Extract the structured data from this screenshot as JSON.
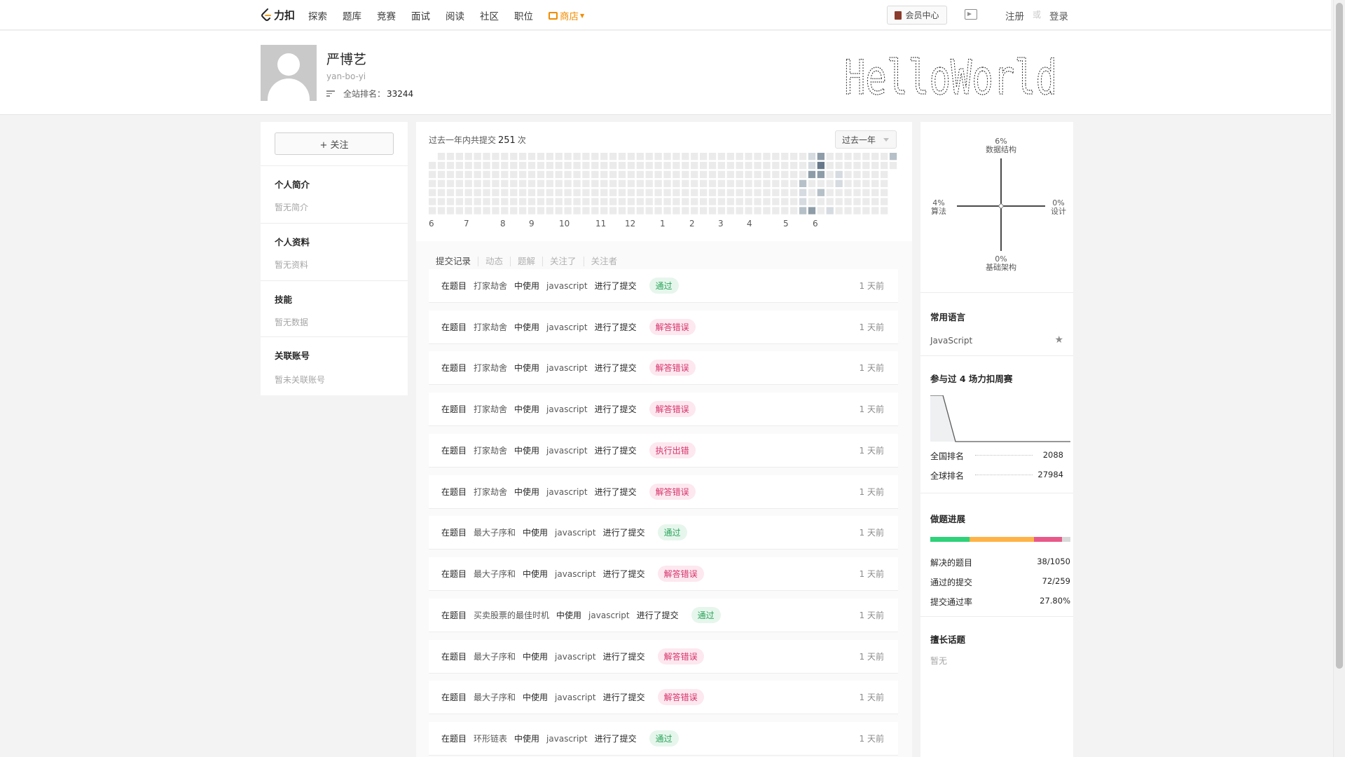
{
  "nav": {
    "logo_text": "力扣",
    "links": [
      "探索",
      "题库",
      "竞赛",
      "面试",
      "阅读",
      "社区",
      "职位"
    ],
    "store_label": "商店",
    "vip_label": "会员中心",
    "register": "注册",
    "or": "或",
    "login": "登录"
  },
  "profile": {
    "name": "严博艺",
    "username": "yan-bo-yi",
    "rank_label": "全站排名：",
    "rank_value": "33244",
    "banner_text": "HelloWorld"
  },
  "left": {
    "follow_label": "+ 关注",
    "sections": [
      {
        "title": "个人简介",
        "value": "暂无简介"
      },
      {
        "title": "个人资料",
        "value": "暂无资料"
      },
      {
        "title": "技能",
        "value": "暂无数据"
      },
      {
        "title": "关联账号",
        "value": "暂未关联账号"
      }
    ]
  },
  "activity": {
    "count_prefix": "过去一年内共提交",
    "count_value": "251",
    "count_suffix": "次",
    "range_label": "过去一年",
    "months": [
      "6",
      "7",
      "8",
      "9",
      "10",
      "11",
      "12",
      "1",
      "2",
      "3",
      "4",
      "5",
      "6"
    ],
    "active_cells": [
      {
        "week": 42,
        "day": 0,
        "level": 1
      },
      {
        "week": 42,
        "day": 1,
        "level": 1
      },
      {
        "week": 42,
        "day": 2,
        "level": 3
      },
      {
        "week": 43,
        "day": 0,
        "level": 3
      },
      {
        "week": 43,
        "day": 1,
        "level": 4
      },
      {
        "week": 43,
        "day": 2,
        "level": 3
      },
      {
        "week": 43,
        "day": 4,
        "level": 2
      },
      {
        "week": 41,
        "day": 3,
        "level": 2
      },
      {
        "week": 41,
        "day": 4,
        "level": 1
      },
      {
        "week": 41,
        "day": 5,
        "level": 1
      },
      {
        "week": 41,
        "day": 6,
        "level": 2
      },
      {
        "week": 42,
        "day": 6,
        "level": 3
      },
      {
        "week": 45,
        "day": 2,
        "level": 1
      },
      {
        "week": 45,
        "day": 3,
        "level": 1
      },
      {
        "week": 44,
        "day": 6,
        "level": 1
      },
      {
        "week": 51,
        "day": 0,
        "level": 2
      }
    ]
  },
  "tabs": [
    "提交记录",
    "动态",
    "题解",
    "关注了",
    "关注者"
  ],
  "submissions": [
    {
      "prefix": "在题目",
      "problem": "打家劫舍",
      "mid": "中使用",
      "lang": "javascript",
      "action": "进行了提交",
      "status": "通过",
      "ok": true,
      "time": "1 天前"
    },
    {
      "prefix": "在题目",
      "problem": "打家劫舍",
      "mid": "中使用",
      "lang": "javascript",
      "action": "进行了提交",
      "status": "解答错误",
      "ok": false,
      "time": "1 天前"
    },
    {
      "prefix": "在题目",
      "problem": "打家劫舍",
      "mid": "中使用",
      "lang": "javascript",
      "action": "进行了提交",
      "status": "解答错误",
      "ok": false,
      "time": "1 天前"
    },
    {
      "prefix": "在题目",
      "problem": "打家劫舍",
      "mid": "中使用",
      "lang": "javascript",
      "action": "进行了提交",
      "status": "解答错误",
      "ok": false,
      "time": "1 天前"
    },
    {
      "prefix": "在题目",
      "problem": "打家劫舍",
      "mid": "中使用",
      "lang": "javascript",
      "action": "进行了提交",
      "status": "执行出错",
      "ok": false,
      "time": "1 天前"
    },
    {
      "prefix": "在题目",
      "problem": "打家劫舍",
      "mid": "中使用",
      "lang": "javascript",
      "action": "进行了提交",
      "status": "解答错误",
      "ok": false,
      "time": "1 天前"
    },
    {
      "prefix": "在题目",
      "problem": "最大子序和",
      "mid": "中使用",
      "lang": "javascript",
      "action": "进行了提交",
      "status": "通过",
      "ok": true,
      "time": "1 天前"
    },
    {
      "prefix": "在题目",
      "problem": "最大子序和",
      "mid": "中使用",
      "lang": "javascript",
      "action": "进行了提交",
      "status": "解答错误",
      "ok": false,
      "time": "1 天前"
    },
    {
      "prefix": "在题目",
      "problem": "买卖股票的最佳时机",
      "mid": "中使用",
      "lang": "javascript",
      "action": "进行了提交",
      "status": "通过",
      "ok": true,
      "time": "1 天前"
    },
    {
      "prefix": "在题目",
      "problem": "最大子序和",
      "mid": "中使用",
      "lang": "javascript",
      "action": "进行了提交",
      "status": "解答错误",
      "ok": false,
      "time": "1 天前"
    },
    {
      "prefix": "在题目",
      "problem": "最大子序和",
      "mid": "中使用",
      "lang": "javascript",
      "action": "进行了提交",
      "status": "解答错误",
      "ok": false,
      "time": "1 天前"
    },
    {
      "prefix": "在题目",
      "problem": "环形链表",
      "mid": "中使用",
      "lang": "javascript",
      "action": "进行了提交",
      "status": "通过",
      "ok": true,
      "time": "1 天前"
    }
  ],
  "skills_radar": {
    "top": {
      "pct": "6%",
      "label": "数据结构"
    },
    "left": {
      "pct": "4%",
      "label": "算法"
    },
    "right": {
      "pct": "0%",
      "label": "设计"
    },
    "bottom": {
      "pct": "0%",
      "label": "基础架构"
    }
  },
  "languages": {
    "title": "常用语言",
    "items": [
      "JavaScript"
    ]
  },
  "contest": {
    "title": "参与过 4 场力扣周赛",
    "national_label": "全国排名",
    "national_value": "2088",
    "global_label": "全球排名",
    "global_value": "27984"
  },
  "progress": {
    "title": "做题进展",
    "colors": [
      "#2dd279",
      "#ffb347",
      "#e8598a",
      "#d9d9d9"
    ],
    "solved_label": "解决的题目",
    "solved_value": "38/1050",
    "accepted_label": "通过的提交",
    "accepted_value": "72/259",
    "rate_label": "提交通过率",
    "rate_value": "27.80%"
  },
  "good_at": {
    "title": "擅长话题",
    "value": "暂无"
  }
}
